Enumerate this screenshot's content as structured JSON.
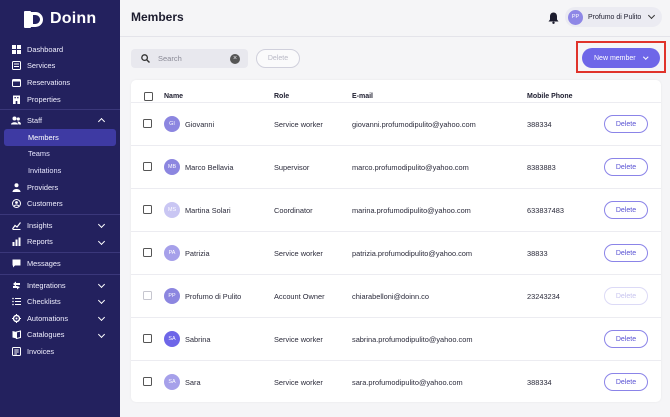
{
  "app": {
    "name": "Doinn"
  },
  "sidebar": {
    "items": [
      {
        "label": "Dashboard",
        "icon": "dashboard-icon"
      },
      {
        "label": "Services",
        "icon": "services-icon"
      },
      {
        "label": "Reservations",
        "icon": "calendar-icon"
      },
      {
        "label": "Properties",
        "icon": "building-icon"
      },
      {
        "label": "Staff",
        "icon": "people-icon"
      },
      {
        "label": "Members"
      },
      {
        "label": "Teams"
      },
      {
        "label": "Invitations"
      },
      {
        "label": "Providers",
        "icon": "providers-icon"
      },
      {
        "label": "Customers",
        "icon": "customers-icon"
      },
      {
        "label": "Insights",
        "icon": "insights-icon"
      },
      {
        "label": "Reports",
        "icon": "reports-icon"
      },
      {
        "label": "Messages",
        "icon": "messages-icon"
      },
      {
        "label": "Integrations",
        "icon": "integrations-icon"
      },
      {
        "label": "Checklists",
        "icon": "checklist-icon"
      },
      {
        "label": "Automations",
        "icon": "automations-icon"
      },
      {
        "label": "Catalogues",
        "icon": "catalogue-icon"
      },
      {
        "label": "Invoices",
        "icon": "invoice-icon"
      }
    ]
  },
  "header": {
    "title": "Members",
    "user": {
      "initials": "PP",
      "name": "Profumo di Pulito"
    }
  },
  "toolbar": {
    "search_placeholder": "Search",
    "delete_label": "Delete",
    "new_member_label": "New member"
  },
  "table": {
    "headers": {
      "name": "Name",
      "role": "Role",
      "email": "E-mail",
      "phone": "Mobile Phone"
    },
    "rows": [
      {
        "initials": "GI",
        "name": "Giovanni",
        "role": "Service worker",
        "email": "giovanni.profumodipulito@yahoo.com",
        "phone": "388334",
        "avatar_color": "#8c86e0",
        "delete": "Delete"
      },
      {
        "initials": "MB",
        "name": "Marco Bellavia",
        "role": "Supervisor",
        "email": "marco.profumodipulito@yahoo.com",
        "phone": "8383883",
        "avatar_color": "#8c86e0",
        "delete": "Delete"
      },
      {
        "initials": "MS",
        "name": "Martina Solari",
        "role": "Coordinator",
        "email": "marina.profumodipulito@yahoo.com",
        "phone": "633837483",
        "avatar_color": "#c9c6f3",
        "delete": "Delete"
      },
      {
        "initials": "PA",
        "name": "Patrizia",
        "role": "Service worker",
        "email": "patrizia.profumodipulito@yahoo.com",
        "phone": "38833",
        "avatar_color": "#a6a0ea",
        "delete": "Delete"
      },
      {
        "initials": "PP",
        "name": "Profumo di Pulito",
        "role": "Account Owner",
        "email": "chiarabelloni@doinn.co",
        "phone": "23243234",
        "avatar_color": "#8c86e0",
        "delete": "Delete",
        "disabled": true
      },
      {
        "initials": "SA",
        "name": "Sabrina",
        "role": "Service worker",
        "email": "sabrina.profumodipulito@yahoo.com",
        "phone": "",
        "avatar_color": "#6e66e8",
        "delete": "Delete"
      },
      {
        "initials": "SA",
        "name": "Sara",
        "role": "Service worker",
        "email": "sara.profumodipulito@yahoo.com",
        "phone": "388334",
        "avatar_color": "#a6a0ea",
        "delete": "Delete"
      }
    ]
  }
}
